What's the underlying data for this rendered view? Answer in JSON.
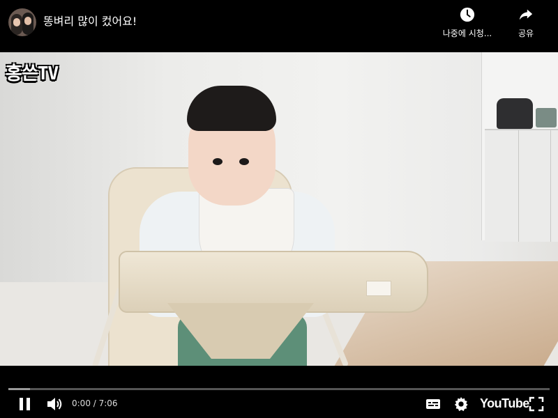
{
  "header": {
    "title": "똥벼리 많이 컸어요!",
    "watch_later_label": "나중에 시청...",
    "share_label": "공유"
  },
  "video": {
    "channel_watermark": "홍쓴TV"
  },
  "player": {
    "current_time": "0:00",
    "duration": "7:06",
    "time_display": "0:00 / 7:06",
    "loaded_fraction": 0.04,
    "played_fraction": 0.0,
    "brand": "YouTube"
  },
  "icons": [
    "channel-avatar",
    "clock-icon",
    "share-arrow-icon",
    "pause-icon",
    "volume-icon",
    "captions-icon",
    "settings-gear-icon",
    "fullscreen-icon"
  ],
  "colors": {
    "background": "#000000",
    "progress_track": "#555555",
    "progress_loaded": "#9a9a9a",
    "progress_played": "#ff0000"
  }
}
